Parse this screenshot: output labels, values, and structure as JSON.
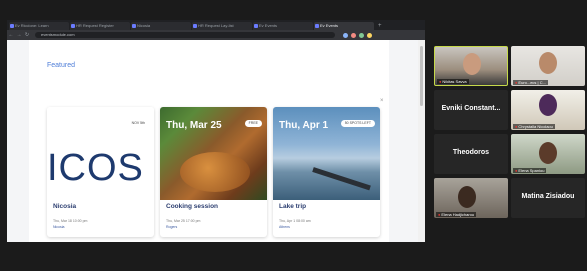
{
  "browser": {
    "tabs": [
      {
        "label": "Ev Riccione: Learn"
      },
      {
        "label": "HR Request Register"
      },
      {
        "label": "Nicosia"
      },
      {
        "label": "HR Request Lay-list"
      },
      {
        "label": "Ev Events"
      },
      {
        "label": "Ev Events"
      }
    ],
    "new_tab": "+",
    "url": "eventsmodule.com"
  },
  "page": {
    "section_title": "Featured",
    "close": "×",
    "cards": [
      {
        "title": "Nicosia",
        "badge": "NOV 5th",
        "date_overlay": "",
        "meta": "Thu, Mar 18 10:00 pm",
        "location": "Nicosia"
      },
      {
        "title": "Cooking session",
        "badge": "FREE",
        "date_overlay": "Thu, Mar 25",
        "meta": "Thu, Mar 25 17:00 pm",
        "location": "Rogers"
      },
      {
        "title": "Lake trip",
        "badge": "50 SPOTS LEFT",
        "date_overlay": "Thu, Apr 1",
        "meta": "Thu, Apr 1 08:00 am",
        "location": "Athens"
      }
    ],
    "icos_text": "ICOS"
  },
  "participants": [
    {
      "name": "Nikitas Savva",
      "kind": "video"
    },
    {
      "name": "Euro...ecs | C...",
      "kind": "video"
    },
    {
      "name": "Evniki Constant...",
      "kind": "name"
    },
    {
      "name": "Chrystalla Nicolaou",
      "kind": "video"
    },
    {
      "name": "Theodoros",
      "kind": "name"
    },
    {
      "name": "Elena Spaniou",
      "kind": "video"
    },
    {
      "name": "Elena Hadjicharou",
      "kind": "video"
    },
    {
      "name": "Matina Zisiadou",
      "kind": "name"
    }
  ],
  "colors": {
    "accent": "#4f7ed8",
    "active_speaker": "#c6d94a",
    "muted_mic": "#e53935"
  }
}
